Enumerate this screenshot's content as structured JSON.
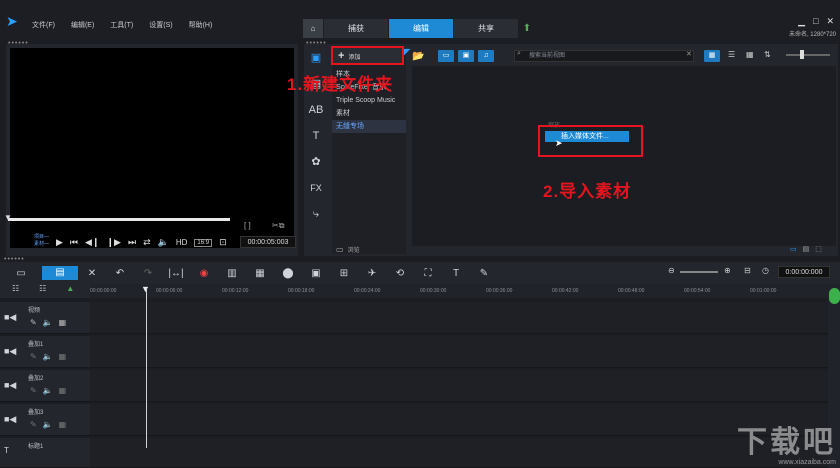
{
  "app": {
    "project_info": "未命名, 1280*720"
  },
  "menu": [
    "文件(F)",
    "编辑(E)",
    "工具(T)",
    "设置(S)",
    "帮助(H)"
  ],
  "tabs": {
    "capture": "捕获",
    "edit": "编辑",
    "share": "共享"
  },
  "library": {
    "add_label": "添加",
    "search_placeholder": "搜索当前视图",
    "folders": [
      "样本",
      "ScoreFitter 音乐",
      "Triple Scoop Music",
      "素材",
      "无缝专场"
    ],
    "browse_label": "浏览"
  },
  "context_menu": {
    "faded_item": "缩放",
    "item": "插入媒体文件..."
  },
  "annotations": {
    "step1": "1.新建文件夹",
    "step2": "2.导入素材"
  },
  "preview": {
    "timecode": "00:00:05:003",
    "mode_labels": [
      "项目—",
      "素材—"
    ],
    "hd": "HD"
  },
  "timeline": {
    "timecode": "0:00:00:000",
    "ruler_ticks": [
      "00:00:00:00",
      "00:00:06:00",
      "00:00:12:00",
      "00:00:18:00",
      "00:00:24:00",
      "00:00:30:00",
      "00:00:36:00",
      "00:00:42:00",
      "00:00:48:00",
      "00:00:54:00",
      "00:01:00:00"
    ],
    "tracks": [
      "视频",
      "叠加1",
      "叠加2",
      "叠加3",
      "标题1"
    ]
  },
  "watermark": {
    "main": "下载吧",
    "url": "www.xiazaiba.com"
  },
  "colors": {
    "accent": "#1e8ad6",
    "annotation": "#e6141e"
  }
}
